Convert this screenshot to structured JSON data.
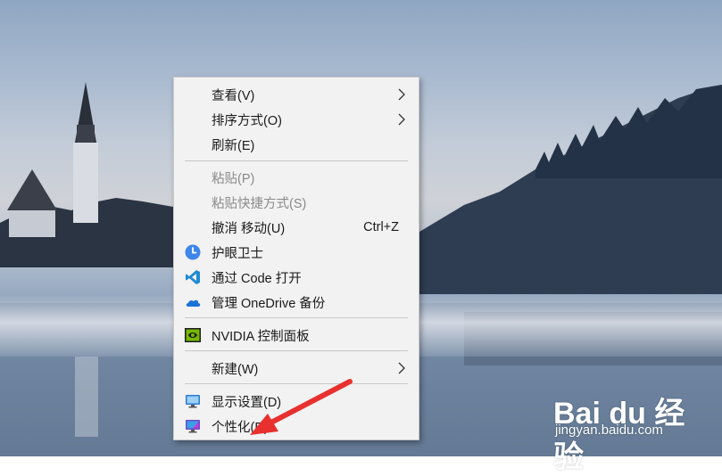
{
  "context_menu": {
    "items": [
      {
        "label": "查看(V)",
        "submenu": true,
        "enabled": true,
        "icon": ""
      },
      {
        "label": "排序方式(O)",
        "submenu": true,
        "enabled": true,
        "icon": ""
      },
      {
        "label": "刷新(E)",
        "submenu": false,
        "enabled": true,
        "icon": ""
      },
      {
        "label": "粘贴(P)",
        "submenu": false,
        "enabled": false,
        "icon": ""
      },
      {
        "label": "粘贴快捷方式(S)",
        "submenu": false,
        "enabled": false,
        "icon": ""
      },
      {
        "label": "撤消 移动(U)",
        "shortcut": "Ctrl+Z",
        "submenu": false,
        "enabled": true,
        "icon": ""
      },
      {
        "label": "护眼卫士",
        "submenu": false,
        "enabled": true,
        "icon": "eye-guard-clock-icon"
      },
      {
        "label": "通过 Code 打开",
        "submenu": false,
        "enabled": true,
        "icon": "vscode-icon"
      },
      {
        "label": "管理 OneDrive 备份",
        "submenu": false,
        "enabled": true,
        "icon": "onedrive-cloud-icon"
      },
      {
        "label": "NVIDIA 控制面板",
        "submenu": false,
        "enabled": true,
        "icon": "nvidia-icon"
      },
      {
        "label": "新建(W)",
        "submenu": true,
        "enabled": true,
        "icon": ""
      },
      {
        "label": "显示设置(D)",
        "submenu": false,
        "enabled": true,
        "icon": "display-settings-icon"
      },
      {
        "label": "个性化(R)",
        "submenu": false,
        "enabled": true,
        "icon": "personalize-icon"
      }
    ]
  },
  "watermark": {
    "logo": "Bai du 经验",
    "url": "jingyan.baidu.com"
  },
  "colors": {
    "menu_bg": "#f2f2f2",
    "disabled_text": "#8a8a8a",
    "annotation_red": "#e8302f",
    "vscode_blue": "#1f8ad2",
    "nvidia_green": "#76b900"
  }
}
